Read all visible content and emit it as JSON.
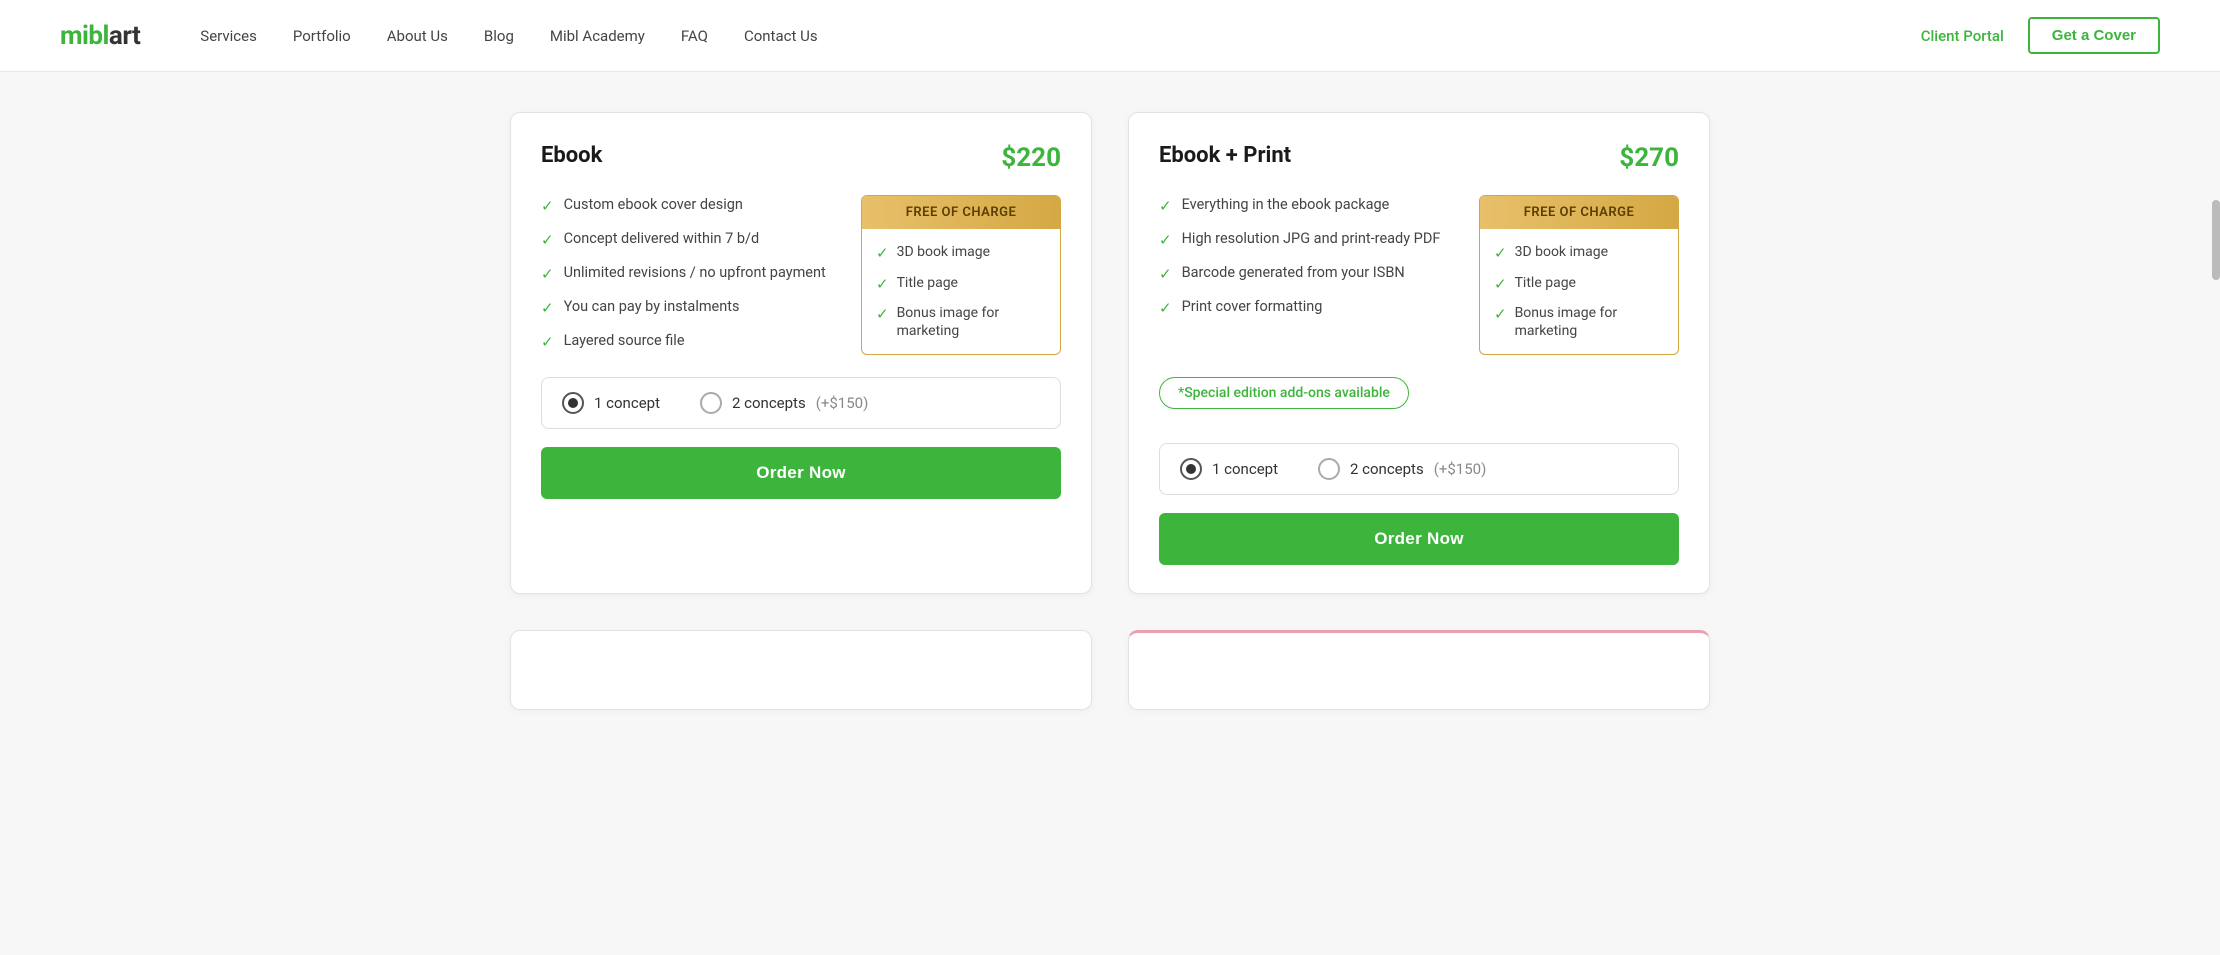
{
  "navbar": {
    "logo_mibl": "mibl",
    "logo_art": "art",
    "links": [
      {
        "label": "Services",
        "href": "#"
      },
      {
        "label": "Portfolio",
        "href": "#"
      },
      {
        "label": "About Us",
        "href": "#"
      },
      {
        "label": "Blog",
        "href": "#"
      },
      {
        "label": "Mibl Academy",
        "href": "#"
      },
      {
        "label": "FAQ",
        "href": "#"
      },
      {
        "label": "Contact Us",
        "href": "#"
      }
    ],
    "client_portal_label": "Client Portal",
    "get_cover_label": "Get a Cover"
  },
  "cards": [
    {
      "id": "ebook",
      "title": "Ebook",
      "price": "$220",
      "features": [
        "Custom ebook cover design",
        "Concept delivered within 7 b/d",
        "Unlimited revisions / no upfront payment",
        "You can pay by instalments",
        "Layered source file"
      ],
      "free_box": {
        "header": "FREE OF CHARGE",
        "items": [
          "3D book image",
          "Title page",
          "Bonus image for marketing"
        ]
      },
      "special_edition": null,
      "concept_options": [
        {
          "label": "1 concept",
          "extra": null,
          "checked": true
        },
        {
          "label": "2 concepts",
          "extra": "(+$150)",
          "checked": false
        }
      ],
      "order_label": "Order Now"
    },
    {
      "id": "ebook-print",
      "title": "Ebook + Print",
      "price": "$270",
      "features": [
        "Everything in the ebook package",
        "High resolution JPG and print-ready PDF",
        "Barcode generated from your ISBN",
        "Print cover formatting"
      ],
      "free_box": {
        "header": "FREE OF CHARGE",
        "items": [
          "3D book image",
          "Title page",
          "Bonus image for marketing"
        ]
      },
      "special_edition": "*Special edition add-ons available",
      "concept_options": [
        {
          "label": "1 concept",
          "extra": null,
          "checked": true
        },
        {
          "label": "2 concepts",
          "extra": "(+$150)",
          "checked": false
        }
      ],
      "order_label": "Order Now"
    }
  ],
  "colors": {
    "green": "#3db53d",
    "gold_dark": "#5a3e00",
    "gold_bg_start": "#e8c06a",
    "gold_bg_end": "#d4a843",
    "gold_border": "#d4a843"
  }
}
